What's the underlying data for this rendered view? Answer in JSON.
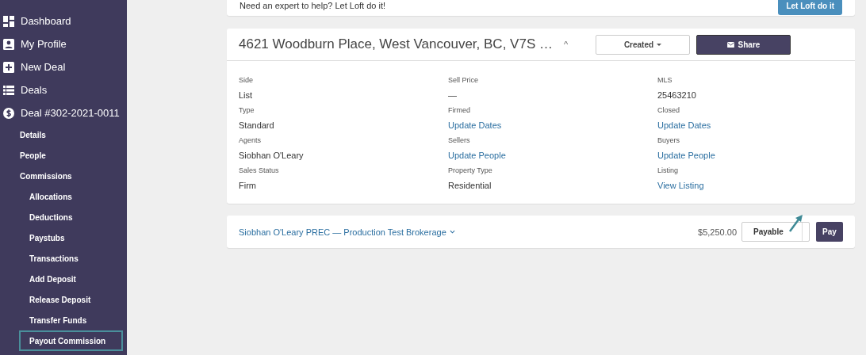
{
  "sidebar": {
    "items": [
      {
        "label": "Dashboard",
        "selected": false
      },
      {
        "label": "My Profile",
        "selected": false
      },
      {
        "label": "New Deal",
        "selected": false
      },
      {
        "label": "Deals",
        "selected": false
      },
      {
        "label": "Deal #302-2021-0011",
        "selected": false,
        "children": [
          {
            "label": "Details",
            "selected": false
          },
          {
            "label": "People",
            "selected": false
          },
          {
            "label": "Commissions",
            "selected": false,
            "children": [
              {
                "label": "Allocations",
                "selected": false
              },
              {
                "label": "Deductions",
                "selected": false
              },
              {
                "label": "Paystubs",
                "selected": false
              },
              {
                "label": "Transactions",
                "selected": false
              },
              {
                "label": "Add Deposit",
                "selected": false
              },
              {
                "label": "Release Deposit",
                "selected": false
              },
              {
                "label": "Transfer Funds",
                "selected": false
              },
              {
                "label": "Payout Commission",
                "selected": true
              }
            ]
          }
        ]
      }
    ]
  },
  "banner": {
    "text": "Need an expert to help? Let Loft do it!",
    "button": "Let Loft do it"
  },
  "deal": {
    "title": "4621 Woodburn Place, West Vancouver, BC, V7S …",
    "collapse": "^",
    "status": "Created",
    "share": "Share",
    "fields": [
      {
        "label": "Side",
        "value": "List",
        "kind": "text"
      },
      {
        "label": "Sell Price",
        "value": "—",
        "kind": "text"
      },
      {
        "label": "MLS",
        "value": "25463210",
        "kind": "text"
      },
      {
        "label": "Type",
        "value": "Standard",
        "kind": "text"
      },
      {
        "label": "Firmed",
        "value": "Update Dates",
        "kind": "link"
      },
      {
        "label": "Closed",
        "value": "Update Dates",
        "kind": "link"
      },
      {
        "label": "Agents",
        "value": "Siobhan O'Leary",
        "kind": "text"
      },
      {
        "label": "Sellers",
        "value": "Update People",
        "kind": "link"
      },
      {
        "label": "Buyers",
        "value": "Update People",
        "kind": "link"
      },
      {
        "label": "Sales Status",
        "value": "Firm",
        "kind": "text"
      },
      {
        "label": "Property Type",
        "value": "Residential",
        "kind": "text"
      },
      {
        "label": "Listing",
        "value": "View Listing",
        "kind": "link"
      }
    ]
  },
  "payout": {
    "recipient": "Siobhan O'Leary PREC — Production Test Brokerage",
    "amount": "$5,250.00",
    "status": "Payable",
    "button": "Pay"
  }
}
